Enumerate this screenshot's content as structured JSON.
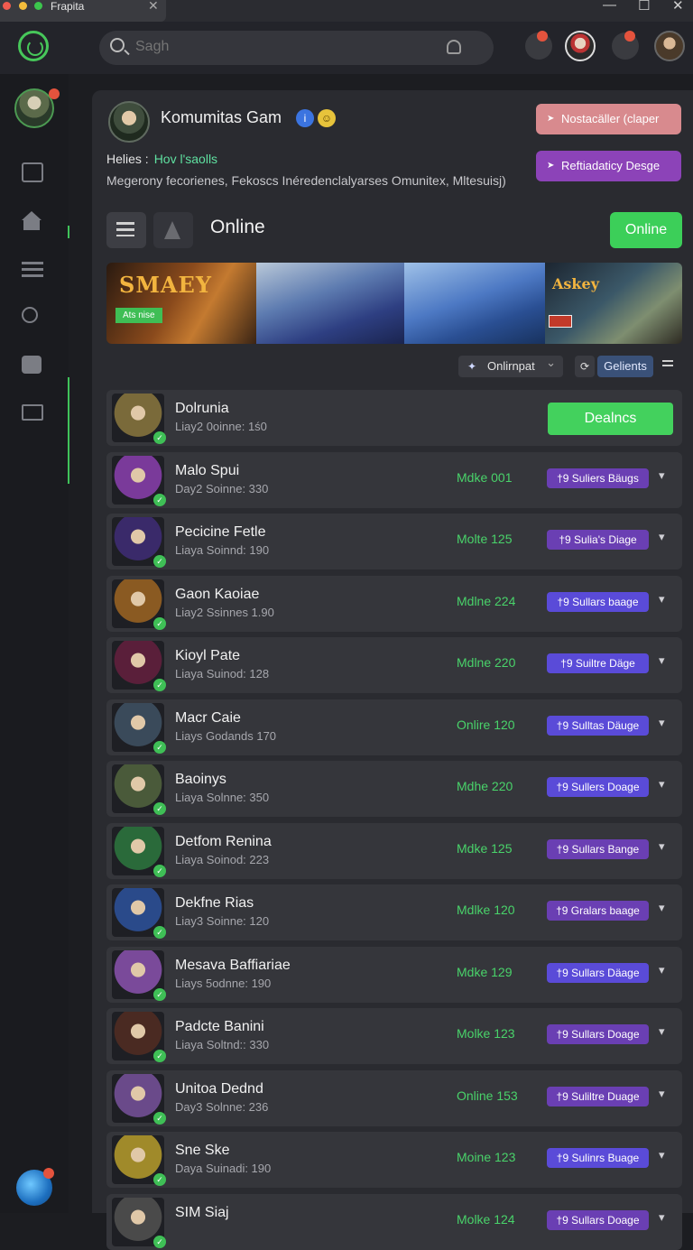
{
  "window": {
    "title": "Frapita"
  },
  "header": {
    "search_placeholder": "Sagh"
  },
  "community": {
    "title": "Komumitas Gam",
    "btn_primary": "Nostacäller (claper",
    "btn_secondary": "Reftiadaticy Desge",
    "helies_label": "Helies :",
    "helies_link": "Hov l'saolls",
    "description": "Megerony fecorienes, Fekoscs Inéredenclalyarses Omunitex, Mltesuisj)",
    "section_title": "Online",
    "online_button": "Online",
    "banner_title": "SMAEY",
    "banner_tag": "Ats nise",
    "banner_title2": "Askey",
    "filter_label": "Onlirnpat",
    "clients_label": "Gelients"
  },
  "rows": [
    {
      "name": "Dolrunia",
      "sub": "Liay2 0oinne: 1ś0",
      "status": "",
      "badge": "",
      "action": "Dealncs",
      "avatar": "#7a6a3a",
      "badge_color": "#6a3fb3"
    },
    {
      "name": "Malo Spui",
      "sub": "Day2 Soinne: 330",
      "status": "Mdke 001",
      "badge": "†9 Suliers Bäugs",
      "action": "",
      "avatar": "#7a3a9a",
      "badge_color": "#6a3fb3"
    },
    {
      "name": "Pecicine Fetle",
      "sub": "Liaya Soinnd: 190",
      "status": "Molte 125",
      "badge": "†9 Sulia's Diage",
      "action": "",
      "avatar": "#3a2a6a",
      "badge_color": "#6a3fb3"
    },
    {
      "name": "Gaon Kaoiae",
      "sub": "Liay2 Ssinnes 1.90",
      "status": "Mdlne 224",
      "badge": "†9 Sullars baage",
      "action": "",
      "avatar": "#8a5a22",
      "badge_color": "#5a4bd8"
    },
    {
      "name": "Kioyl Pate",
      "sub": "Liaya Suinod: 128",
      "status": "Mdlne 220",
      "badge": "†9 Suiltre Däge",
      "action": "",
      "avatar": "#5a1f3a",
      "badge_color": "#5a4bd8"
    },
    {
      "name": "Macr Caie",
      "sub": "Liays Godands 170",
      "status": "Onlire 120",
      "badge": "†9 Sulltas Däuge",
      "action": "",
      "avatar": "#3a4a5a",
      "badge_color": "#5a4bd8"
    },
    {
      "name": "Baoinys",
      "sub": "Liaya Solnne: 350",
      "status": "Mdhe 220",
      "badge": "†9 Sullers Doage",
      "action": "",
      "avatar": "#4a5a3a",
      "badge_color": "#5a4bd8"
    },
    {
      "name": "Detfom Renina",
      "sub": "Liaya Soinod: 223",
      "status": "Mdke 125",
      "badge": "†9 Sullars Bange",
      "action": "",
      "avatar": "#2a6a3a",
      "badge_color": "#6a3fb3"
    },
    {
      "name": "Dekfne Rias",
      "sub": "Liay3 Soinne: 120",
      "status": "Mdlke 120",
      "badge": "†9 Gralars baage",
      "action": "",
      "avatar": "#2a4a8a",
      "badge_color": "#6a3fb3"
    },
    {
      "name": "Mesava Baffiariae",
      "sub": "Liays 5odnne: 190",
      "status": "Mdke 129",
      "badge": "†9 Sullars Däage",
      "action": "",
      "avatar": "#7a4a9a",
      "badge_color": "#5a4bd8"
    },
    {
      "name": "Padcte Banini",
      "sub": "Liaya Soltnd:: 330",
      "status": "Molke 123",
      "badge": "†9 Sullars Doage",
      "action": "",
      "avatar": "#4a2a22",
      "badge_color": "#6a3fb3"
    },
    {
      "name": "Unitoa Dednd",
      "sub": "Day3 Solnne: 236",
      "status": "Online 153",
      "badge": "†9 Suliltre Duage",
      "action": "",
      "avatar": "#6a4a8a",
      "badge_color": "#6a3fb3"
    },
    {
      "name": "Sne Ske",
      "sub": "Daya Suinadi: 190",
      "status": "Moine 123",
      "badge": "†9 Sulinrs Buage",
      "action": "",
      "avatar": "#a08a2a",
      "badge_color": "#5a4bd8"
    },
    {
      "name": "SIM Siaj",
      "sub": "",
      "status": "Molke 124",
      "badge": "†9 Sullars Doage",
      "action": "",
      "avatar": "#4a4a4a",
      "badge_color": "#6a3fb3"
    }
  ]
}
